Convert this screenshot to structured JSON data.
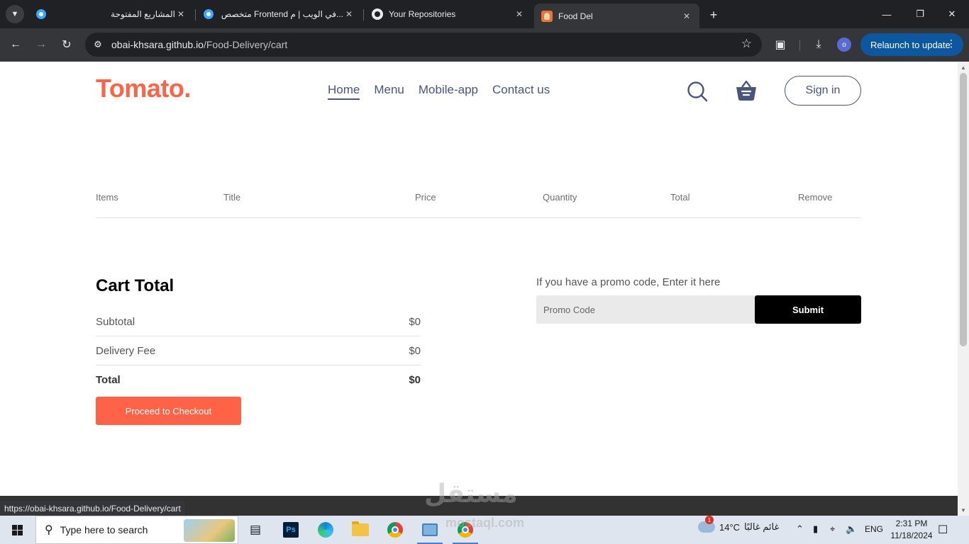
{
  "browser": {
    "tabs": [
      {
        "title": "المشاريع المفتوحة",
        "icon": "mostaql-icon",
        "active": false
      },
      {
        "title": "متخصص Frontend في الويب | م...",
        "icon": "mostaql-icon",
        "active": false
      },
      {
        "title": "Your Repositories",
        "icon": "github-icon",
        "active": false
      },
      {
        "title": "Food Del",
        "icon": "food-del-icon",
        "active": true
      }
    ],
    "url_host": "obai-khsara.github.io",
    "url_path": "/Food-Delivery/cart",
    "profile_initial": "o",
    "relaunch_label": "Relaunch to update",
    "status_url": "https://obai-khsara.github.io/Food-Delivery/cart"
  },
  "site": {
    "logo": "Tomato.",
    "nav": [
      {
        "label": "Home",
        "active": true
      },
      {
        "label": "Menu",
        "active": false
      },
      {
        "label": "Mobile-app",
        "active": false
      },
      {
        "label": "Contact us",
        "active": false
      }
    ],
    "sign_in": "Sign in",
    "brand_color": "#ff6347",
    "nav_color": "#49557e"
  },
  "cart": {
    "columns": [
      "Items",
      "Title",
      "Price",
      "Quantity",
      "Total",
      "Remove"
    ],
    "totals_title": "Cart Total",
    "subtotal_label": "Subtotal",
    "subtotal_value": "$0",
    "delivery_label": "Delivery Fee",
    "delivery_value": "$0",
    "total_label": "Total",
    "total_value": "$0",
    "checkout_label": "Proceed to Checkout",
    "promo_text": "If you have a promo code, Enter it here",
    "promo_placeholder": "Promo Code",
    "submit_label": "Submit"
  },
  "watermark": {
    "text": "مستقل",
    "sub": "mostaql.com"
  },
  "taskbar": {
    "search_placeholder": "Type here to search",
    "weather_temp": "14°C",
    "weather_desc": "غائم غالبًا",
    "weather_alerts": "1",
    "language": "ENG",
    "time": "2:31 PM",
    "date": "11/18/2024"
  }
}
